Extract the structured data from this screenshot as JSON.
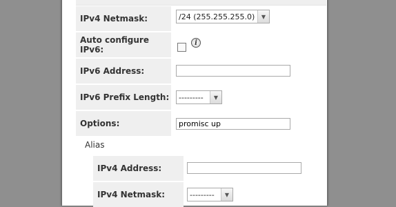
{
  "form": {
    "ipv4_netmask": {
      "label": "IPv4 Netmask:",
      "value": "/24 (255.255.255.0)"
    },
    "auto_configure_ipv6": {
      "label": "Auto configure IPv6:",
      "checked": false
    },
    "ipv6_address": {
      "label": "IPv6 Address:",
      "value": ""
    },
    "ipv6_prefix_length": {
      "label": "IPv6 Prefix Length:",
      "value": "---------"
    },
    "options": {
      "label": "Options:",
      "value": "promisc up"
    }
  },
  "alias": {
    "heading": "Alias",
    "ipv4_address": {
      "label": "IPv4 Address:",
      "value": ""
    },
    "ipv4_netmask": {
      "label": "IPv4 Netmask:",
      "value": "---------"
    }
  },
  "icons": {
    "info": "info-icon",
    "dropdown_arrow": "chevron-down-icon"
  },
  "colors": {
    "backdrop": "#8f8f8f",
    "label_bg": "#efefef",
    "dialog_bg": "#ffffff"
  }
}
